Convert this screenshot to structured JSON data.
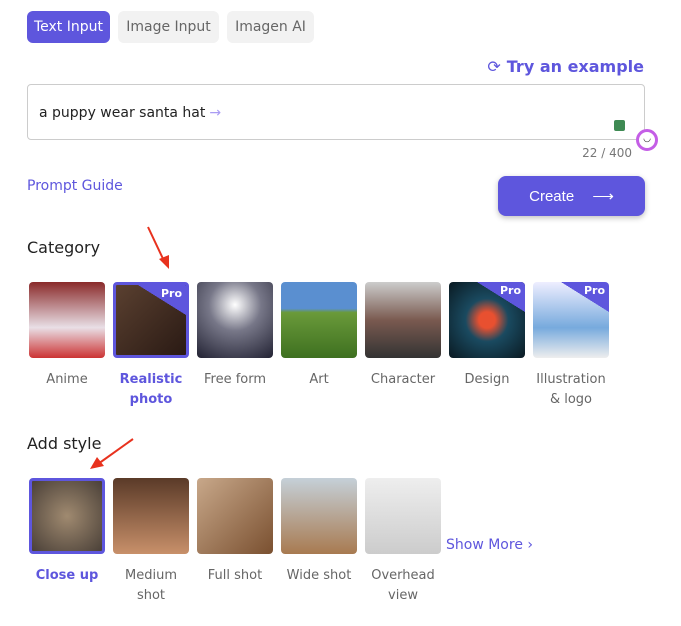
{
  "tabs": [
    {
      "label": "Text Input",
      "active": true
    },
    {
      "label": "Image Input"
    },
    {
      "label": "Imagen AI"
    }
  ],
  "try_example": "Try an example",
  "prompt": {
    "value": "a puppy wear santa hat",
    "count": "22 / 400"
  },
  "prompt_guide": "Prompt Guide",
  "create_label": "Create",
  "category": {
    "title": "Category",
    "items": [
      {
        "label": "Anime"
      },
      {
        "label": "Realistic photo",
        "selected": true,
        "pro": true
      },
      {
        "label": "Free form"
      },
      {
        "label": "Art"
      },
      {
        "label": "Character"
      },
      {
        "label": "Design",
        "pro": true
      },
      {
        "label": "Illustration & logo",
        "pro": true
      }
    ]
  },
  "pro_badge": "Pro",
  "style": {
    "title": "Add style",
    "items": [
      {
        "label": "Close up",
        "selected": true
      },
      {
        "label": "Medium shot"
      },
      {
        "label": "Full shot"
      },
      {
        "label": "Wide shot"
      },
      {
        "label": "Overhead view"
      }
    ],
    "show_more": "Show More"
  },
  "colors": {
    "accent": "#5e56dd"
  }
}
